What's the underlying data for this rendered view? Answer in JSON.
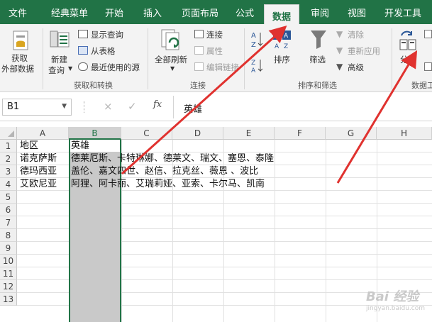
{
  "tabs": [
    {
      "label": "文件"
    },
    {
      "label": "经典菜单"
    },
    {
      "label": "开始"
    },
    {
      "label": "插入"
    },
    {
      "label": "页面布局"
    },
    {
      "label": "公式"
    },
    {
      "label": "数据"
    },
    {
      "label": "审阅"
    },
    {
      "label": "视图"
    },
    {
      "label": "开发工具"
    }
  ],
  "ribbon": {
    "get_data_line1": "获取",
    "get_data_line2": "外部数据",
    "new_query_line1": "新建",
    "new_query_line2": "查询",
    "show_queries": "显示查询",
    "from_table": "从表格",
    "recent_sources": "最近使用的源",
    "group_get_transform": "获取和转换",
    "refresh_all": "全部刷新",
    "connections": "连接",
    "properties": "属性",
    "edit_links": "编辑链接",
    "group_connections": "连接",
    "sort": "排序",
    "filter": "筛选",
    "clear": "清除",
    "reapply": "重新应用",
    "advanced": "高级",
    "group_sort_filter": "排序和筛选",
    "text_to_columns": "分列",
    "group_data_tools": "数据工"
  },
  "formula_bar": {
    "name_box": "B1",
    "cancel": "×",
    "enter": "✓",
    "fx": "fx",
    "value": "英雄"
  },
  "columns": [
    "A",
    "B",
    "C",
    "D",
    "E",
    "F",
    "G",
    "H"
  ],
  "rows": [
    "1",
    "2",
    "3",
    "4",
    "5",
    "6",
    "7",
    "8",
    "9",
    "10",
    "11",
    "12",
    "13"
  ],
  "cells": {
    "A1": "地区",
    "B1": "英雄",
    "A2": "诺克萨斯",
    "B2": "德莱厄斯、卡特琳娜、德莱文、瑞文、塞恩、泰隆",
    "A3": "德玛西亚",
    "B3": "盖伦、嘉文四世、赵信、拉克丝、薇恩 、波比",
    "A4": "艾欧尼亚",
    "B4": "阿狸、阿卡丽、艾瑞莉娅、亚索、卡尔马、凯南"
  },
  "watermark": {
    "text": "Bai 经验",
    "url": "jingyan.baidu.com"
  },
  "colors": {
    "accent": "#217346",
    "arrow": "#e0322f"
  }
}
